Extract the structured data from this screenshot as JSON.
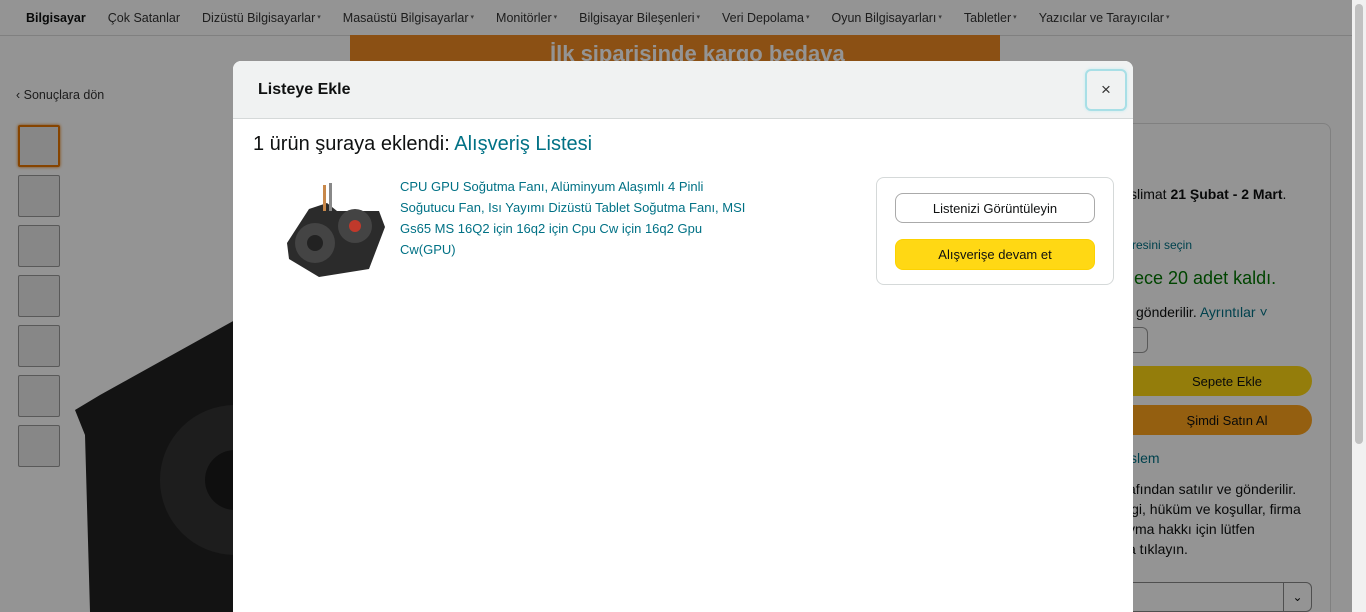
{
  "nav": {
    "items": [
      {
        "label": "Bilgisayar",
        "bold": true,
        "caret": false
      },
      {
        "label": "Çok Satanlar",
        "bold": false,
        "caret": false
      },
      {
        "label": "Dizüstü Bilgisayarlar",
        "bold": false,
        "caret": true
      },
      {
        "label": "Masaüstü Bilgisayarlar",
        "bold": false,
        "caret": true
      },
      {
        "label": "Monitörler",
        "bold": false,
        "caret": true
      },
      {
        "label": "Bilgisayar Bileşenleri",
        "bold": false,
        "caret": true
      },
      {
        "label": "Veri Depolama",
        "bold": false,
        "caret": true
      },
      {
        "label": "Oyun Bilgisayarları",
        "bold": false,
        "caret": true
      },
      {
        "label": "Tabletler",
        "bold": false,
        "caret": true
      },
      {
        "label": "Yazıcılar ve Tarayıcılar",
        "bold": false,
        "caret": true
      }
    ]
  },
  "banner": {
    "text": "İlk siparişinde kargo bedava"
  },
  "page": {
    "back_label": "‹ Sonuçlara dön"
  },
  "buybox": {
    "delivery_prefix": "slimat",
    "delivery_dates": "21 Şubat - 2 Mart",
    "select_location": "resini seçin",
    "stock": "lece 20 adet kaldı.",
    "ships_text": "gönderilir.",
    "details_link": "Ayrıntılar",
    "add_to_cart": "Sepete Ekle",
    "buy_now": "Şimdi Satın Al",
    "secure": "slem",
    "seller_lines": [
      "afından satılır ve gönderilir.",
      "lgi, hüküm ve koşullar, firma",
      "yma hakkı için lütfen",
      "a tıklayın."
    ]
  },
  "modal": {
    "title": "Listeye Ekle",
    "close_glyph": "×",
    "added_prefix": "1 ürün şuraya eklendi:",
    "list_name": "Alışveriş Listesi",
    "product_title": "CPU GPU Soğutma Fanı, Alüminyum Alaşımlı 4 Pinli Soğutucu Fan, Isı Yayımı Dizüstü Tablet Soğutma Fanı, MSI Gs65 MS 16Q2 için 16q2 için Cpu Cw için 16q2 Gpu Cw(GPU)",
    "view_list_button": "Listenizi Görüntüleyin",
    "continue_button": "Alışverişe devam et"
  },
  "colors": {
    "link": "#007185",
    "primary_button": "#ffd814",
    "buy_now": "#ffa41c",
    "focus_ring": "#a8dfe6"
  }
}
